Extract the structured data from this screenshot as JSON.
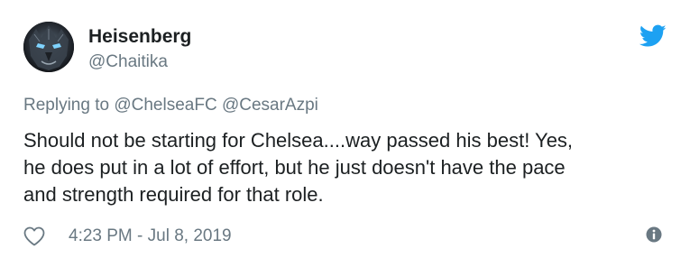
{
  "tweet": {
    "author": {
      "display_name": "Heisenberg",
      "screen_name": "@Chaitika",
      "avatar_icon": "lion-avatar-icon"
    },
    "reply_context": {
      "prefix": "Replying to ",
      "mentions": [
        "@ChelseaFC",
        "@CesarAzpi"
      ]
    },
    "text": "Should not be starting for Chelsea....way passed his best!  Yes,\nhe does put in a lot of effort, but he just doesn't have the pace\nand strength required for that role.",
    "timestamp": "4:23 PM - Jul 8, 2019",
    "icons": {
      "brand": "twitter-bird-icon",
      "like": "heart-icon",
      "info": "info-icon"
    },
    "colors": {
      "brand_blue": "#1da1f2",
      "secondary_text": "#697882",
      "primary_text": "#1c2022"
    }
  }
}
